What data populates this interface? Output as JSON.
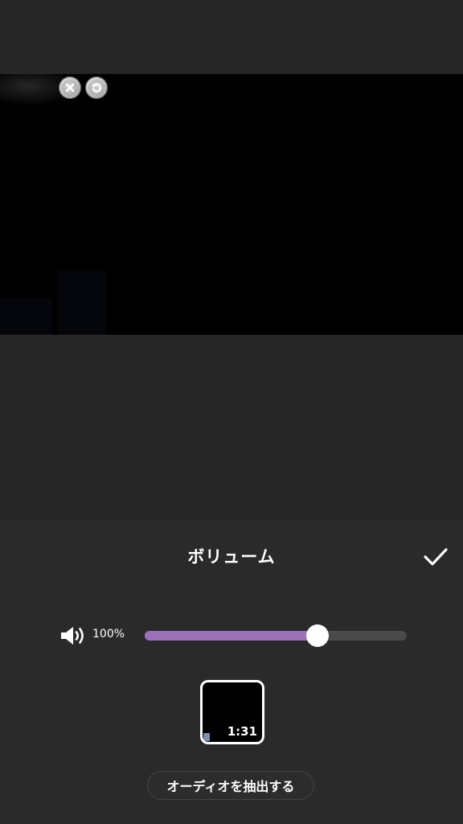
{
  "preview": {
    "overlay_buttons": [
      {
        "icon": "close-icon"
      },
      {
        "icon": "undo-icon"
      }
    ]
  },
  "panel": {
    "title": "ボリューム",
    "confirm_icon": "checkmark-icon"
  },
  "volume": {
    "icon": "speaker-icon",
    "label": "100%",
    "slider_fraction": 0.66,
    "fill_color": "#9b72b8",
    "track_color": "#4a4a4a"
  },
  "clip": {
    "duration": "1:31"
  },
  "actions": {
    "extract_audio_label": "オーディオを抽出する"
  }
}
